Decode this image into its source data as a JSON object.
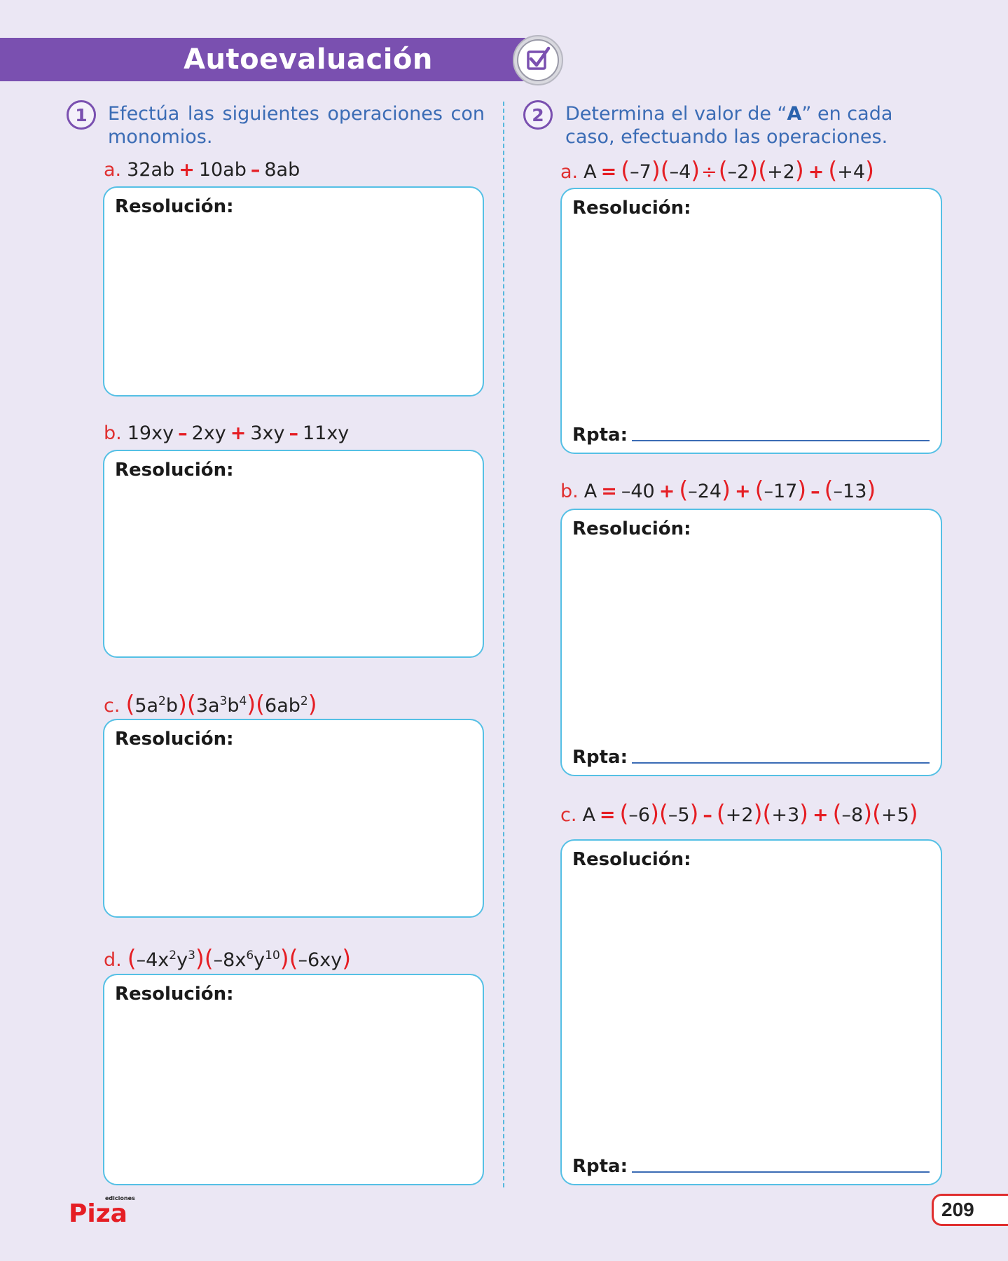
{
  "header": {
    "title": "Autoevaluación"
  },
  "q1": {
    "number": "1",
    "instruction": "Efectúa las siguientes operaciones con monomios.",
    "items": [
      {
        "letter": "a.",
        "p1": "32ab",
        "op1": "+",
        "p2": "10ab",
        "op2": "–",
        "p3": "8ab"
      },
      {
        "letter": "b.",
        "p1": "19xy",
        "op1": "–",
        "p2": "2xy",
        "op2": "+",
        "p3": "3xy",
        "op3": "–",
        "p4": "11xy"
      },
      {
        "letter": "c.",
        "f1a": "5a",
        "f1b": "2",
        "f1c": "b",
        "f2a": "3a",
        "f2b": "3",
        "f2c": "b",
        "f2d": "4",
        "f3a": "6ab",
        "f3b": "2"
      },
      {
        "letter": "d.",
        "f1a": "–4x",
        "f1b": "2",
        "f1c": "y",
        "f1d": "3",
        "f2a": "–8x",
        "f2b": "6",
        "f2c": "y",
        "f2d": "10",
        "f3a": "–6xy"
      }
    ]
  },
  "q2": {
    "number": "2",
    "instruction_pre": "Determina el valor de “",
    "instruction_a": "A",
    "instruction_post": "” en cada caso, efectuando las operaciones.",
    "items": [
      {
        "letter": "a.",
        "lhs": "A",
        "eq": "=",
        "t1": "–7",
        "t2": "–4",
        "div": "÷",
        "t3": "–2",
        "t4": "+2",
        "op": "+",
        "t5": "+4"
      },
      {
        "letter": "b.",
        "lhs": "A",
        "eq": "=",
        "t0": "–40",
        "op1": "+",
        "t1": "–24",
        "op2": "+",
        "t2": "–17",
        "op3": "–",
        "t3": "–13"
      },
      {
        "letter": "c.",
        "lhs": "A",
        "eq": "=",
        "t1": "–6",
        "t2": "–5",
        "op1": "–",
        "t3": "+2",
        "t4": "+3",
        "op2": "+",
        "t5": "–8",
        "t6": "+5"
      }
    ]
  },
  "labels": {
    "resolution": "Resolución:",
    "answer": "Rpta:"
  },
  "footer": {
    "logo_small": "ediciones",
    "logo": "Piza",
    "page_number": "209"
  },
  "colors": {
    "purple": "#7a50b0",
    "red": "#e51e24",
    "blue": "#3b6cb5",
    "box_border": "#55c0e5",
    "background": "#ebe7f4"
  }
}
